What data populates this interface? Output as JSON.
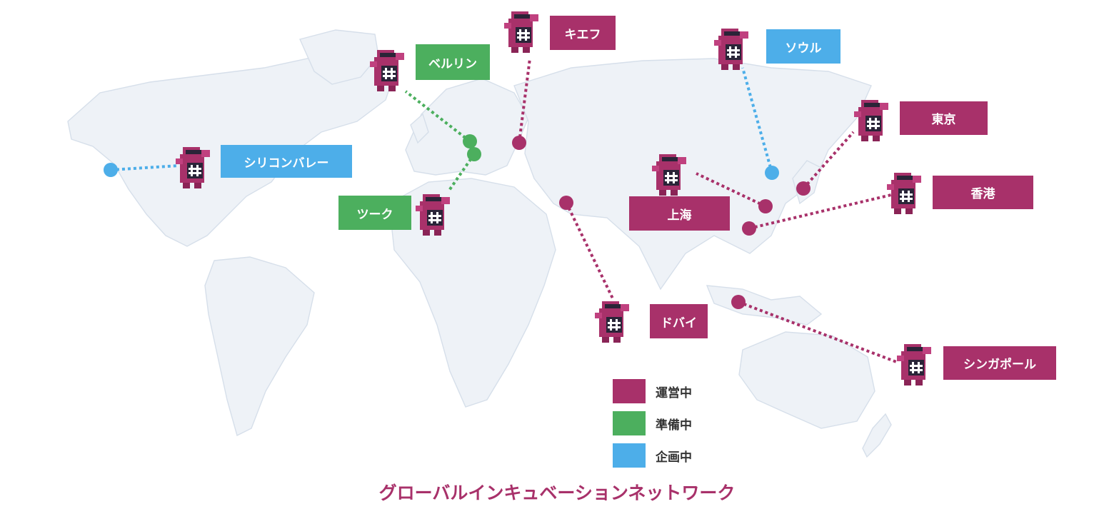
{
  "colors": {
    "operating": "#a8316a",
    "preparing": "#4caf5e",
    "planning": "#4daee9"
  },
  "locations": {
    "silicon_valley": {
      "label": "シリコンバレー",
      "status": "planning"
    },
    "berlin": {
      "label": "ベルリン",
      "status": "preparing"
    },
    "zug": {
      "label": "ツーク",
      "status": "preparing"
    },
    "kiev": {
      "label": "キエフ",
      "status": "operating"
    },
    "seoul": {
      "label": "ソウル",
      "status": "planning"
    },
    "tokyo": {
      "label": "東京",
      "status": "operating"
    },
    "shanghai": {
      "label": "上海",
      "status": "operating"
    },
    "hongkong": {
      "label": "香港",
      "status": "operating"
    },
    "dubai": {
      "label": "ドバイ",
      "status": "operating"
    },
    "singapore": {
      "label": "シンガポール",
      "status": "operating"
    }
  },
  "legend": [
    {
      "label": "運営中",
      "status": "operating"
    },
    {
      "label": "準備中",
      "status": "preparing"
    },
    {
      "label": "企画中",
      "status": "planning"
    }
  ],
  "mascot_icon": "hash-mascot-icon",
  "title": "グローバルインキュベーションネットワーク"
}
